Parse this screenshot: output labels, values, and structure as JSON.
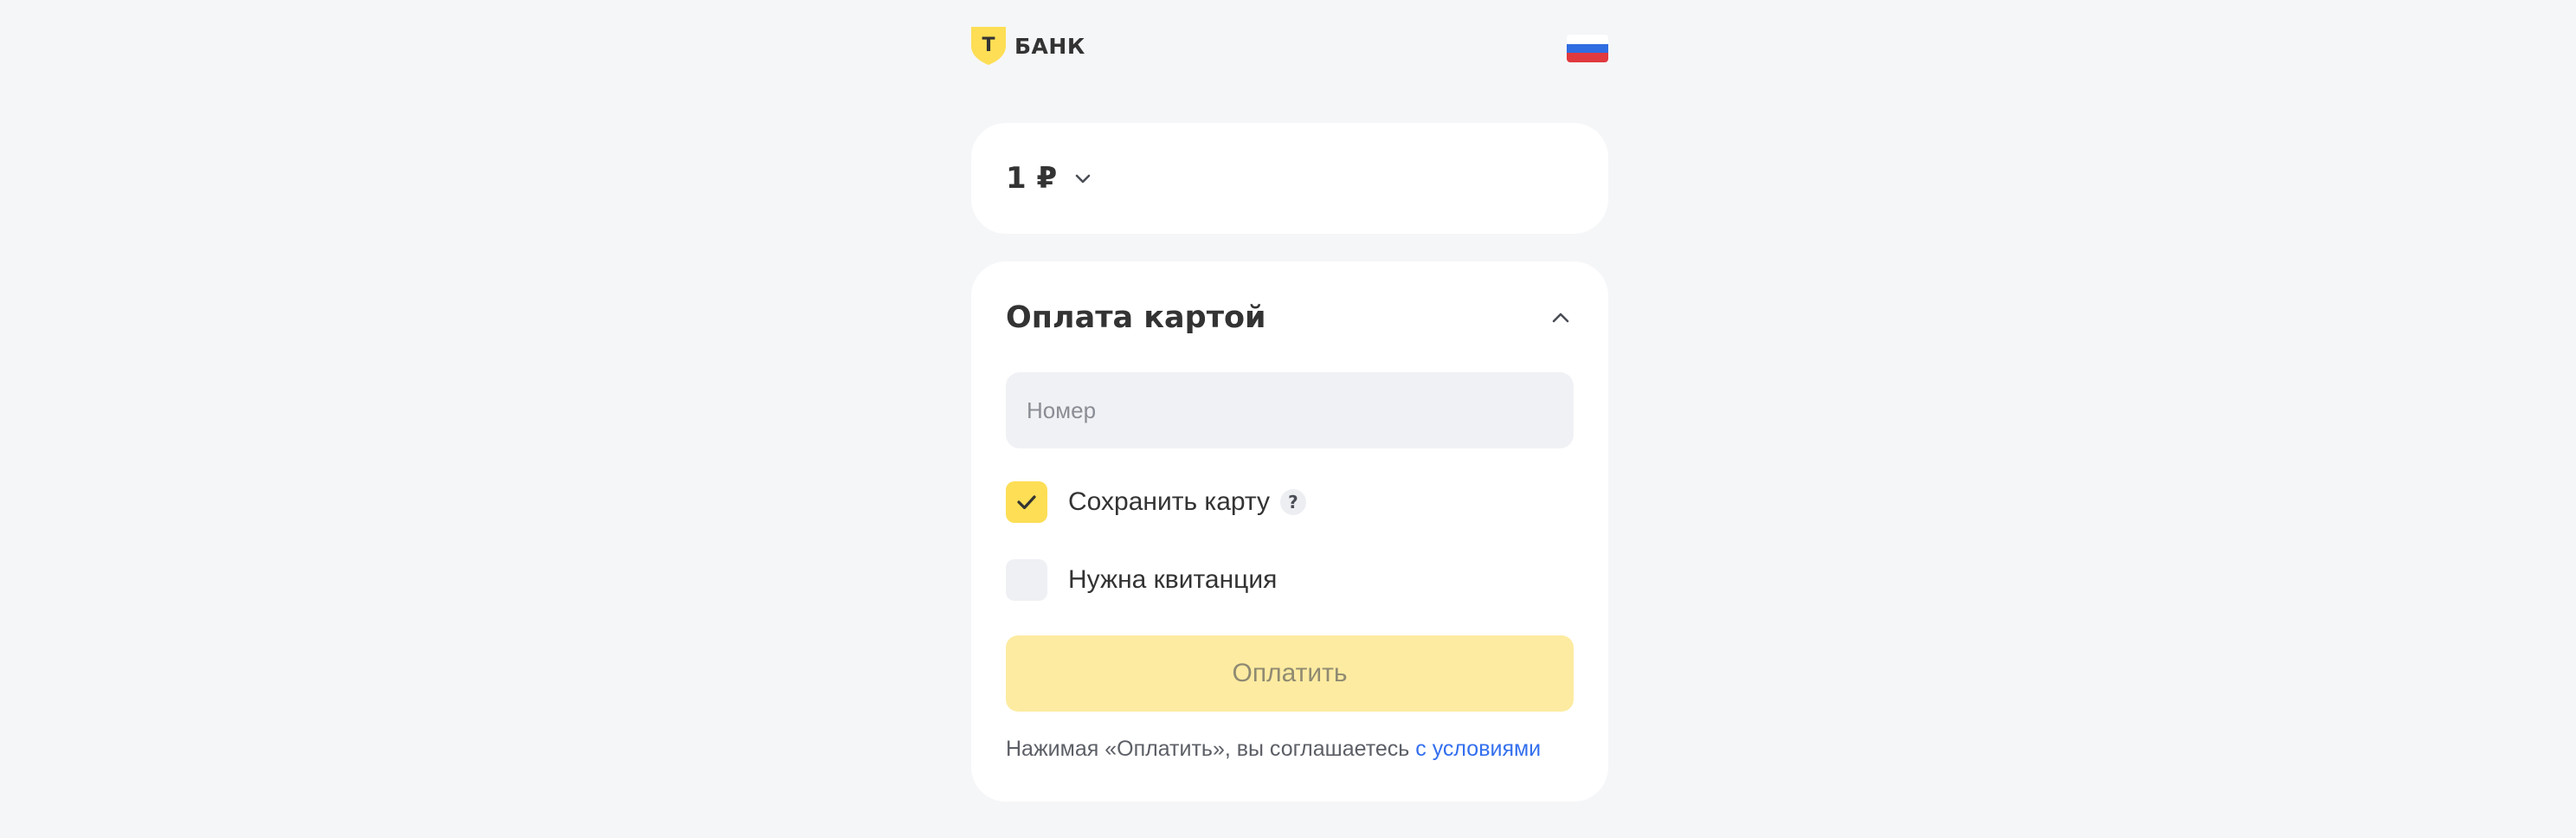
{
  "header": {
    "logo_text": "БАНК",
    "logo_letter": "Т",
    "language_flag": "russia-flag",
    "flag_colors": [
      "#ffffff",
      "#2f6de1",
      "#e0393e"
    ]
  },
  "amount": {
    "value": "1 ₽",
    "chevron_icon": "chevron-down-icon"
  },
  "payment": {
    "title": "Оплата картой",
    "collapse_icon": "chevron-up-icon",
    "card_number_placeholder": "Номер",
    "card_number_value": "",
    "save_card": {
      "label": "Сохранить карту",
      "checked": true,
      "help": "?"
    },
    "receipt": {
      "label": "Нужна квитанция",
      "checked": false
    },
    "pay_button_label": "Оплатить",
    "terms_text": "Нажимая «Оплатить», вы соглашаетесь ",
    "terms_link": "с условиями"
  },
  "colors": {
    "accent_yellow": "#fdde55",
    "button_disabled_yellow": "#fdeba1",
    "link_blue": "#336fee",
    "background": "#f5f6f8"
  }
}
